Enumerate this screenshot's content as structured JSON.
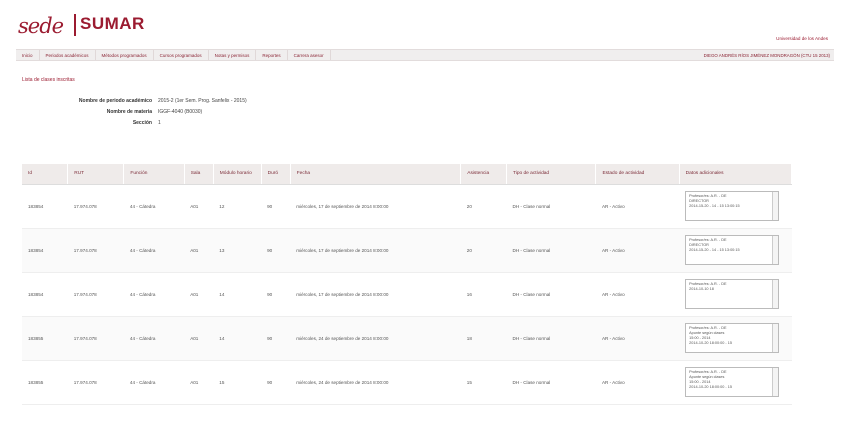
{
  "app": {
    "logo_script": "sede",
    "logo_name": "SUMAR",
    "top_link": "Universidad de los Andes"
  },
  "nav": {
    "items": [
      "Inicio",
      "Periodos académicos",
      "Métodos programados",
      "Cursos programados",
      "Notas y permisos",
      "Reportes",
      "Carrera asesor"
    ],
    "user": "DIEGO ANDRÉS RÍOS JIMÉNEZ MONDRAGÓN (CTU 15 2013)"
  },
  "breadcrumb": "Lista de clases inscritas",
  "info": [
    {
      "label": "Nombre de periodo académico",
      "value": "2015-2 (1er Sem. Prog. Sanfelix - 2015)"
    },
    {
      "label": "Nombre de materia",
      "value": "IGGF-4040 (B0030)"
    },
    {
      "label": "Sección",
      "value": "1"
    }
  ],
  "table": {
    "headers": [
      "Id",
      "RUT",
      "Función",
      "Sala",
      "Módulo horario",
      "Duró",
      "Fecha",
      "Asistencia",
      "Tipo de actividad",
      "Estado de actividad",
      "Datos adicionales"
    ],
    "rows": [
      {
        "id": "183854",
        "rut": "17.974.078",
        "funcion": "44 - Cátedra",
        "sala": "A01",
        "modulo": "12",
        "duro": "90",
        "fecha": "miércoles, 17 de septiembre de 2014 8:00:00",
        "asistencia": "20",
        "tipo": "DH - Clase normal",
        "estado": "AR - Activo",
        "detalle": [
          "Profesor/es: A.R. - DE",
          "DIRECTOR",
          "2014-15-20 - 14 - 15 13:00:15"
        ]
      },
      {
        "id": "183854",
        "rut": "17.974.078",
        "funcion": "44 - Cátedra",
        "sala": "A01",
        "modulo": "13",
        "duro": "90",
        "fecha": "miércoles, 17 de septiembre de 2014 8:00:00",
        "asistencia": "20",
        "tipo": "DH - Clase normal",
        "estado": "AR - Activo",
        "detalle": [
          "Profesor/es: A.R. - DE",
          "DIRECTOR",
          "2014-15-20 - 14 - 15 13:00:15"
        ]
      },
      {
        "id": "183854",
        "rut": "17.974.078",
        "funcion": "44 - Cátedra",
        "sala": "A01",
        "modulo": "14",
        "duro": "90",
        "fecha": "miércoles, 17 de septiembre de 2014 8:00:00",
        "asistencia": "16",
        "tipo": "DH - Clase normal",
        "estado": "AR - Activo",
        "detalle": [
          "Profesor/es: A.R. - DE",
          "2014-10-10 18"
        ]
      },
      {
        "id": "183855",
        "rut": "17.974.078",
        "funcion": "44 - Cátedra",
        "sala": "A01",
        "modulo": "14",
        "duro": "90",
        "fecha": "miércoles, 24 de septiembre de 2014 8:00:00",
        "asistencia": "18",
        "tipo": "DH - Clase normal",
        "estado": "AR - Activo",
        "detalle": [
          "Profesor/es: A.R. - DE",
          "Apunte según clases",
          "15:00 - 2014",
          "2014-10-20 18:00:00 - 15"
        ]
      },
      {
        "id": "183855",
        "rut": "17.974.078",
        "funcion": "44 - Cátedra",
        "sala": "A01",
        "modulo": "15",
        "duro": "90",
        "fecha": "miércoles, 24 de septiembre de 2014 8:00:00",
        "asistencia": "15",
        "tipo": "DH - Clase normal",
        "estado": "AR - Activo",
        "detalle": [
          "Profesor/es: A.R. - DE",
          "Apunte según clases",
          "15:00 - 2014",
          "2014-10-20 18:00:00 - 15"
        ]
      }
    ]
  }
}
